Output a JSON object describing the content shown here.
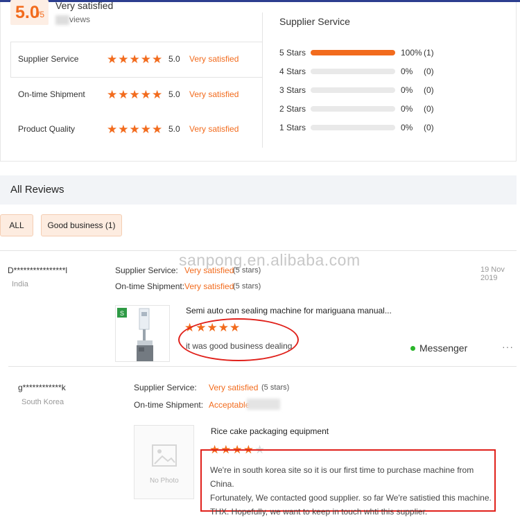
{
  "summary": {
    "score": "5.0",
    "score_suffix": "/5",
    "overall_label": "Very satisfied",
    "reviews_text": "views",
    "metrics": [
      {
        "name": "Supplier Service",
        "score": "5.0",
        "label": "Very satisfied",
        "stars": 5
      },
      {
        "name": "On-time Shipment",
        "score": "5.0",
        "label": "Very satisfied",
        "stars": 5
      },
      {
        "name": "Product Quality",
        "score": "5.0",
        "label": "Very satisfied",
        "stars": 5
      }
    ],
    "distribution_title": "Supplier Service",
    "distribution": [
      {
        "label": "5 Stars",
        "percent_text": "100%",
        "count": "(1)",
        "fraction": 1.0
      },
      {
        "label": "4 Stars",
        "percent_text": "0%",
        "count": "(0)",
        "fraction": 0
      },
      {
        "label": "3 Stars",
        "percent_text": "0%",
        "count": "(0)",
        "fraction": 0
      },
      {
        "label": "2 Stars",
        "percent_text": "0%",
        "count": "(0)",
        "fraction": 0
      },
      {
        "label": "1 Stars",
        "percent_text": "0%",
        "count": "(0)",
        "fraction": 0
      }
    ]
  },
  "all_reviews": {
    "title": "All Reviews",
    "filters": [
      {
        "label": "ALL"
      },
      {
        "label": "Good business (1)"
      }
    ]
  },
  "watermark": "sanpong.en.alibaba.com",
  "reviews": [
    {
      "name": "D****************l",
      "country": "India",
      "date": "19 Nov 2019",
      "supplier_service_label": "Supplier Service:",
      "supplier_service_value": "Very satisfied",
      "supplier_service_stars": "(5 stars)",
      "shipment_label": "On-time Shipment:",
      "shipment_value": "Very satisfied",
      "shipment_stars": "(5 stars)",
      "product_title": "Semi auto can sealing machine for mariguana manual...",
      "rating": 5,
      "text": "it was good business dealing",
      "messenger": "Messenger",
      "more": "···"
    },
    {
      "name": "g************k",
      "country": "South Korea",
      "supplier_service_label": "Supplier Service:",
      "supplier_service_value": "Very satisfied",
      "supplier_service_stars": "(5 stars)",
      "shipment_label": "On-time Shipment:",
      "shipment_value": "Acceptable",
      "product_title": "Rice cake packaging equipment",
      "rating": 4,
      "no_photo": "No Photo",
      "text_lines": [
        "We're in south korea site so it is our first time to purchase machine from China.",
        "Fortunately, We contacted good supplier. so far We're satistied this machine.",
        "THX. Hopefully, we want to keep in touch whti this supplier."
      ]
    }
  ],
  "colors": {
    "accent": "#f26b1d",
    "highlight": "#e0201a",
    "online": "#2ab52a"
  }
}
